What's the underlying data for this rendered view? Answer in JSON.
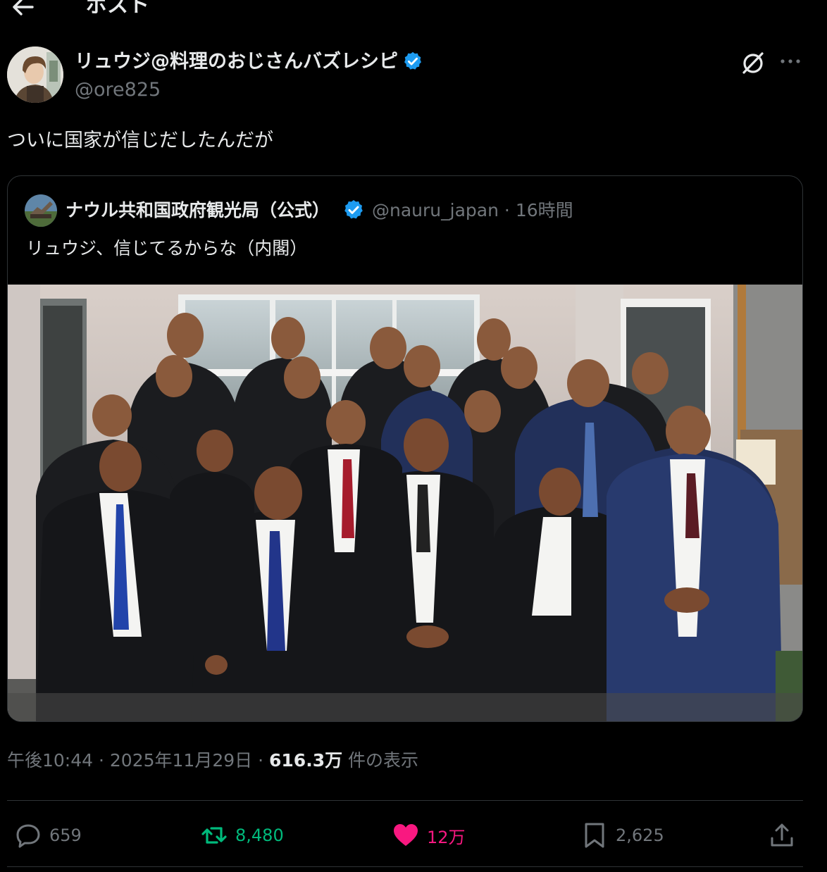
{
  "header": {
    "title": "ポスト"
  },
  "author": {
    "name": "リュウジ@料理のおじさんバズレシピ",
    "handle": "@ore825"
  },
  "post": {
    "text": "ついに国家が信じだしたんだが"
  },
  "quoted": {
    "name": "ナウル共和国政府観光局（公式）",
    "handle": "@nauru_japan",
    "separator": "·",
    "time": "16時間",
    "text": "リュウジ、信じてるからな（内閣）"
  },
  "meta": {
    "time": "午後10:44",
    "separator1": "·",
    "date": "2025年11月29日",
    "separator2": "·",
    "views_count": "616.3万",
    "views_label": " 件の表示"
  },
  "actions": {
    "replies": "659",
    "retweets": "8,480",
    "likes": "12万",
    "bookmarks": "2,625"
  },
  "colors": {
    "background": "#000000",
    "text": "#e7e9ea",
    "muted": "#71767b",
    "verified": "#1d9bf0",
    "retweet": "#00ba7c",
    "like": "#f91880"
  }
}
